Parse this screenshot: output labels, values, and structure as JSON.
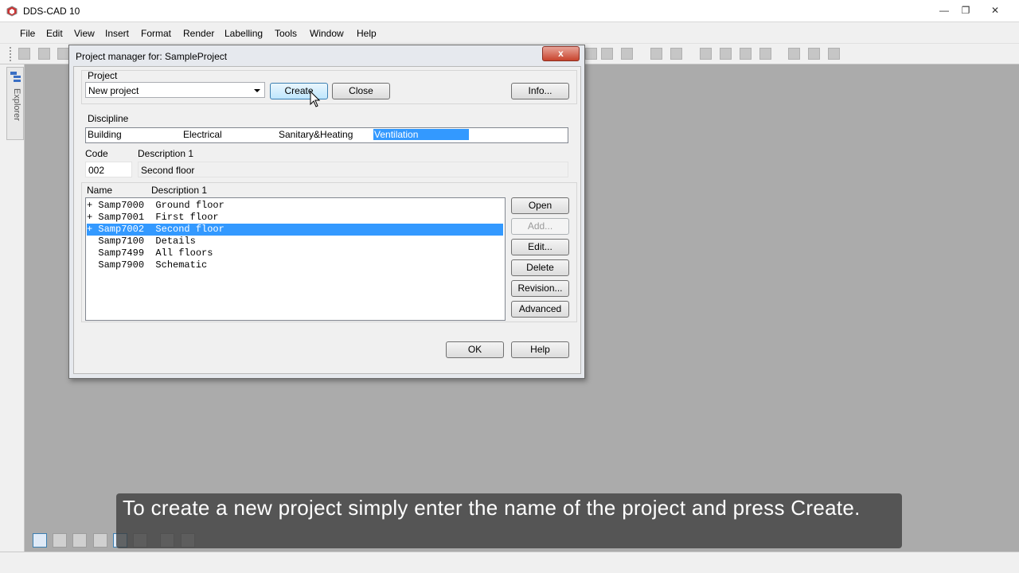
{
  "app": {
    "title": "DDS-CAD 10"
  },
  "menu": [
    "File",
    "Edit",
    "View",
    "Insert",
    "Format",
    "Render",
    "Labelling",
    "Tools",
    "Window",
    "Help"
  ],
  "explorer": {
    "label": "Explorer"
  },
  "dialog": {
    "title": "Project manager for: SampleProject",
    "close_label": "x",
    "project_label": "Project",
    "project_value": "New project",
    "create_label": "Create",
    "close_button_label": "Close",
    "info_label": "Info...",
    "discipline_label": "Discipline",
    "disciplines": [
      "Building",
      "Electrical",
      "Sanitary&Heating",
      "Ventilation"
    ],
    "selected_discipline": "Ventilation",
    "code_label": "Code",
    "desc_label": "Description 1",
    "code_value": "002",
    "desc_value": "Second floor",
    "list_name_header": "Name",
    "list_desc_header": "Description 1",
    "drawings": [
      {
        "prefix": "+",
        "name": "Samp7000",
        "desc": "Ground floor"
      },
      {
        "prefix": "+",
        "name": "Samp7001",
        "desc": "First floor"
      },
      {
        "prefix": "+",
        "name": "Samp7002",
        "desc": "Second floor",
        "selected": true
      },
      {
        "prefix": " ",
        "name": "Samp7100",
        "desc": "Details"
      },
      {
        "prefix": " ",
        "name": "Samp7499",
        "desc": "All floors"
      },
      {
        "prefix": " ",
        "name": "Samp7900",
        "desc": "Schematic"
      }
    ],
    "side_buttons": {
      "open": "Open",
      "add": "Add...",
      "edit": "Edit...",
      "delete": "Delete",
      "revision": "Revision...",
      "advanced": "Advanced"
    },
    "ok_label": "OK",
    "help_label": "Help"
  },
  "caption": "To create a new project simply enter the name of the project and press Create.",
  "colors": {
    "selection": "#3399ff",
    "workspace": "#ababab",
    "close_red": "#c7432c"
  }
}
